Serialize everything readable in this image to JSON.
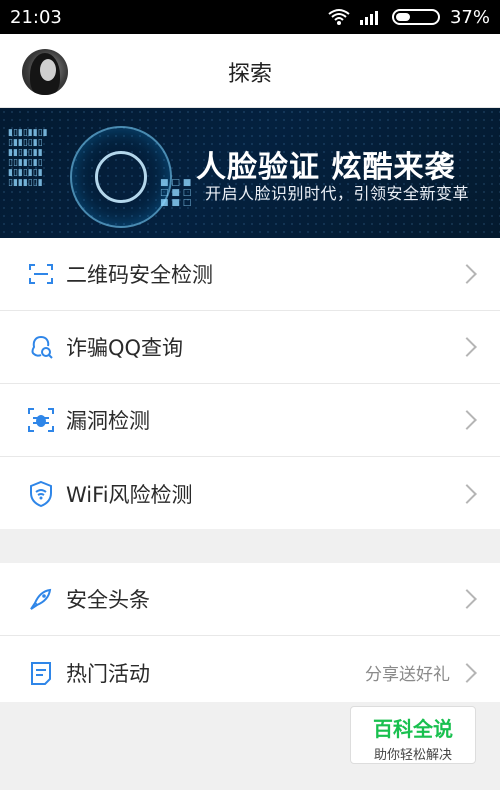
{
  "status": {
    "time": "21:03",
    "battery": "37%",
    "battery_level": 0.37
  },
  "header": {
    "title": "探索"
  },
  "banner": {
    "headline": "人脸验证 炫酷来袭",
    "subline": "开启人脸识别时代，引领安全新变革"
  },
  "menu_group1": [
    {
      "label": "二维码安全检测",
      "icon": "qr-scan-icon"
    },
    {
      "label": "诈骗QQ查询",
      "icon": "qq-search-icon"
    },
    {
      "label": "漏洞检测",
      "icon": "bug-icon"
    },
    {
      "label": "WiFi风险检测",
      "icon": "wifi-shield-icon"
    }
  ],
  "menu_group2": [
    {
      "label": "安全头条",
      "icon": "rocket-icon",
      "trail": ""
    },
    {
      "label": "热门活动",
      "icon": "note-icon",
      "trail": "分享送好礼"
    }
  ],
  "watermark": {
    "title": "百科全说",
    "subtitle": "助你轻松解决"
  },
  "colors": {
    "accent": "#2f86e8",
    "watermark_green": "#19c04f",
    "banner_bg": "#031a31"
  }
}
